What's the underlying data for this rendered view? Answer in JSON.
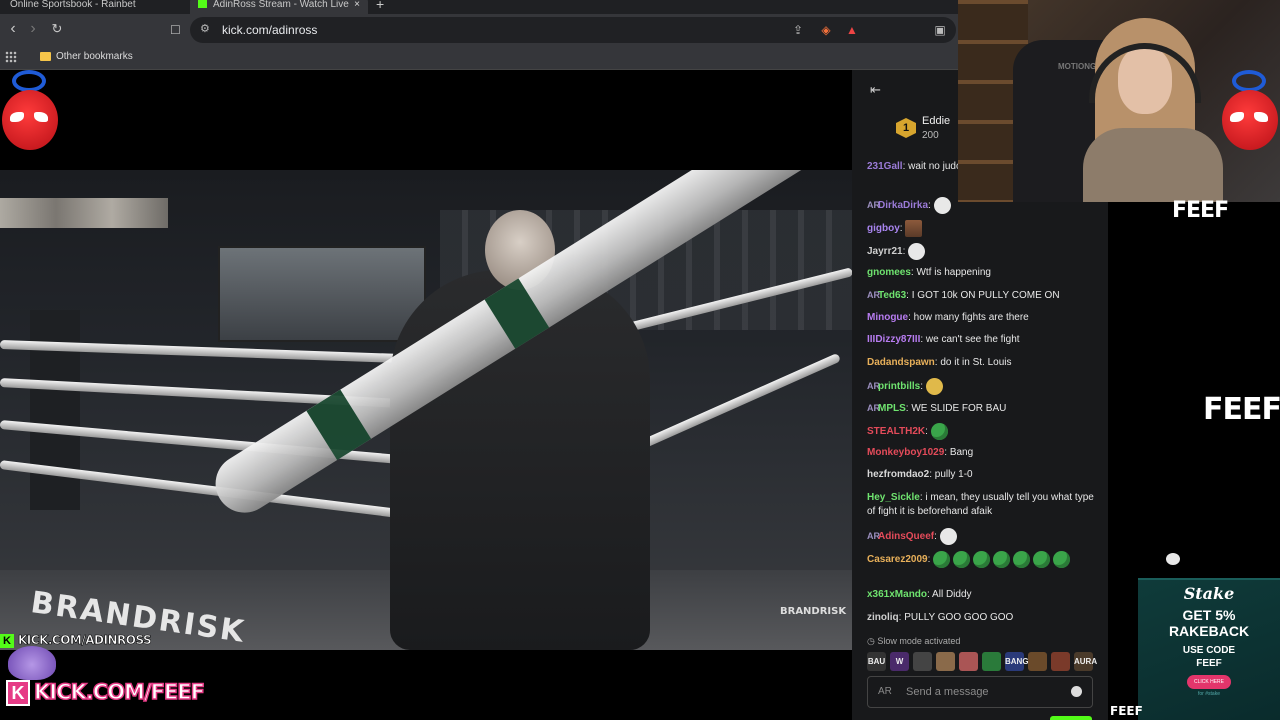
{
  "browser": {
    "tabs": [
      {
        "label": "Online Sportsbook - Rainbet"
      },
      {
        "label": "AdinRoss Stream - Watch Live"
      }
    ],
    "url": "kick.com/adinross",
    "bookmark_folder": "Other bookmarks",
    "extension_badge": "1"
  },
  "video": {
    "apron_text": "BRANDRISK",
    "watermark": "BRANDRISK"
  },
  "chat": {
    "leaderboard": {
      "rank": "1",
      "name": "Eddie",
      "amount": "200"
    },
    "messages": [
      {
        "user": "231Gall",
        "color": "#9b7bd8",
        "text": "wait no judo guy",
        "badge": ""
      },
      {
        "user": "DirkaDirka",
        "color": "#9b7bd8",
        "text": "",
        "badge": "AR",
        "emotes": [
          "white"
        ]
      },
      {
        "user": "gigboy",
        "color": "#a985f0",
        "text": "",
        "badge": "",
        "emotes": [
          "photo"
        ]
      },
      {
        "user": "Jayrr21",
        "color": "#cfcfcf",
        "text": "",
        "badge": "",
        "emotes": [
          "white"
        ]
      },
      {
        "user": "gnomees",
        "color": "#6fe36f",
        "text": "Wtf is happening",
        "badge": ""
      },
      {
        "user": "Ted63",
        "color": "#6fe36f",
        "text": "I GOT 10k ON PULLY COME ON",
        "badge": "AR"
      },
      {
        "user": "Minogue",
        "color": "#b77cf0",
        "text": "how many fights are there",
        "badge": ""
      },
      {
        "user": "IIIDizzy87III",
        "color": "#b77cf0",
        "text": "we can't see the fight",
        "badge": ""
      },
      {
        "user": "Dadandspawn",
        "color": "#e8b05a",
        "text": "do it in St. Louis",
        "badge": ""
      },
      {
        "user": "printbills",
        "color": "#6fe36f",
        "text": "",
        "badge": "AR",
        "emotes": [
          "yellow"
        ]
      },
      {
        "user": "MPLS",
        "color": "#6fe36f",
        "text": "WE SLIDE FOR BAU",
        "badge": "AR"
      },
      {
        "user": "STEALTH2K",
        "color": "#e44b5a",
        "text": "",
        "badge": "",
        "emotes": [
          "green"
        ]
      },
      {
        "user": "Monkeyboy1029",
        "color": "#e44b5a",
        "text": "Bang",
        "badge": ""
      },
      {
        "user": "hezfromdao2",
        "color": "#d8d8d8",
        "text": "pully 1-0",
        "badge": ""
      },
      {
        "user": "Hey_Sickle",
        "color": "#6fe36f",
        "text": "i mean, they usually tell you what type of fight it is beforehand afaik",
        "badge": ""
      },
      {
        "user": "AdinsQueef",
        "color": "#e44b5a",
        "text": "",
        "badge": "AR",
        "emotes": [
          "white"
        ]
      },
      {
        "user": "Casarez2009",
        "color": "#e8b05a",
        "text": "",
        "badge": "",
        "emotes": [
          "green",
          "green",
          "green",
          "green",
          "green",
          "green",
          "green"
        ]
      },
      {
        "user": "x361xMando",
        "color": "#6fe36f",
        "text": "All Diddy",
        "badge": ""
      },
      {
        "user": "zinoliq",
        "color": "#cfcfcf",
        "text": "PULLY GOO GOO GOO",
        "badge": ""
      }
    ],
    "slow_mode": "Slow mode activated",
    "emote_bar": [
      "BAU",
      "W",
      "",
      "",
      "",
      "",
      "BANG",
      "",
      "",
      "AURA"
    ],
    "input_placeholder": "Send a message"
  },
  "overlay": {
    "webcam_chair_text": "MOTIONGREY",
    "feef_top": "FEEF",
    "feef_mid": "FEEF",
    "feef_corner": "FEEF",
    "stake": {
      "logo": "Stake",
      "line1": "GET 5%",
      "line2": "RAKEBACK",
      "line3": "USE CODE",
      "line4": "FEEF",
      "button": "CLICK HERE",
      "footer": "for #stake"
    },
    "kick_small": "KICK.COM/ADINROSS",
    "kick_big": "KICK.COM/FEEF",
    "kick_letter": "K"
  },
  "colors": {
    "kick_green": "#53fc18",
    "chat_bg": "#18191b",
    "stake_bg": "#0f3b3a"
  }
}
